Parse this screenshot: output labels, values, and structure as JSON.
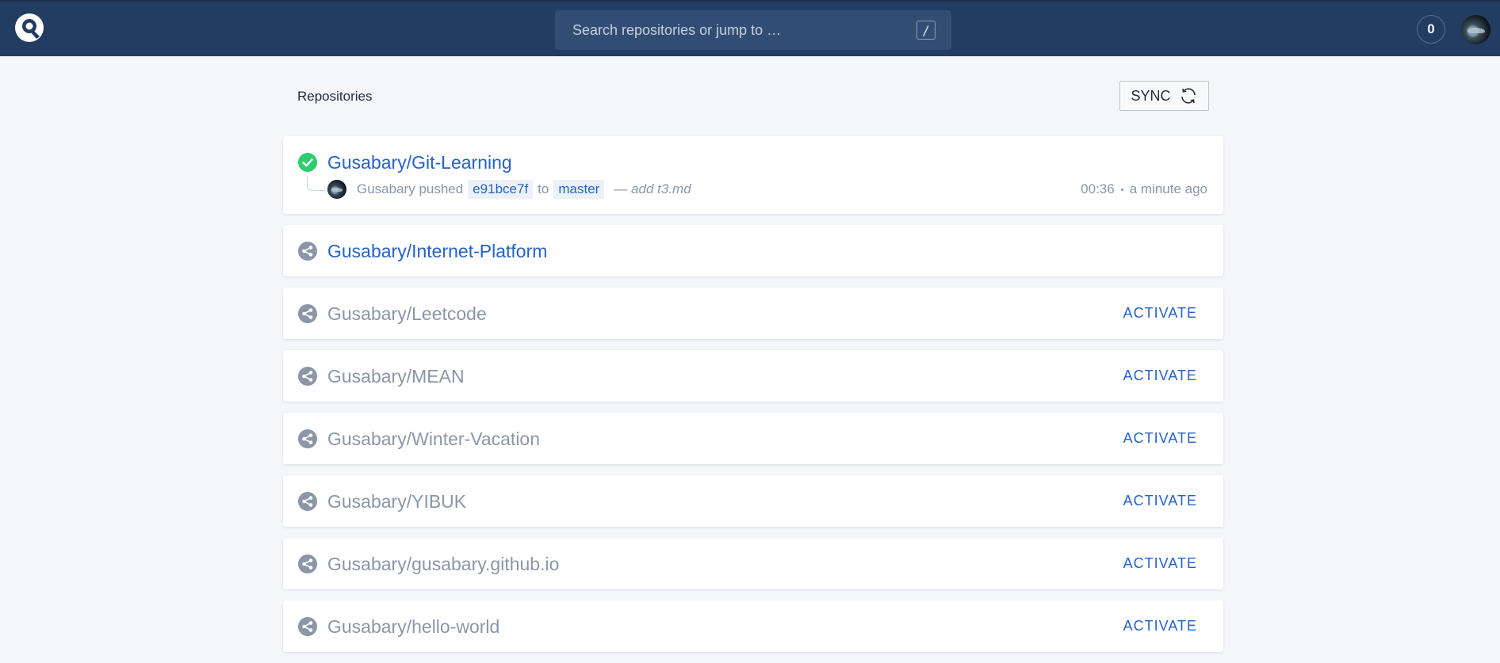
{
  "header": {
    "search_placeholder": "Search repositories or jump to …",
    "search_shortcut": "/",
    "notification_count": "0"
  },
  "page": {
    "title": "Repositories",
    "sync_label": "SYNC"
  },
  "colors": {
    "topbar": "#233c61",
    "link": "#2463c7",
    "success": "#2ecc71",
    "muted": "#8b96a6"
  },
  "repos": [
    {
      "name": "Gusabary/Git-Learning",
      "status": "success",
      "build": {
        "author": "Gusabary",
        "action": "pushed",
        "commit": "e91bce7f",
        "to": "to",
        "branch": "master",
        "message": "— add t3.md",
        "duration": "00:36",
        "time": "a minute ago"
      }
    },
    {
      "name": "Gusabary/Internet-Platform",
      "status": "linked"
    },
    {
      "name": "Gusabary/Leetcode",
      "status": "inactive",
      "action": "ACTIVATE"
    },
    {
      "name": "Gusabary/MEAN",
      "status": "inactive",
      "action": "ACTIVATE"
    },
    {
      "name": "Gusabary/Winter-Vacation",
      "status": "inactive",
      "action": "ACTIVATE"
    },
    {
      "name": "Gusabary/YIBUK",
      "status": "inactive",
      "action": "ACTIVATE"
    },
    {
      "name": "Gusabary/gusabary.github.io",
      "status": "inactive",
      "action": "ACTIVATE"
    },
    {
      "name": "Gusabary/hello-world",
      "status": "inactive",
      "action": "ACTIVATE"
    }
  ]
}
